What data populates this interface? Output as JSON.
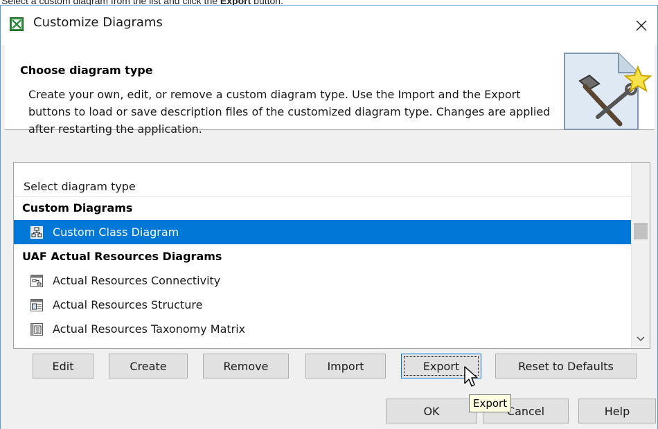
{
  "caption": {
    "prefix": "Select a custom diagram from the list and click the ",
    "bold": "Export",
    "suffix": " button."
  },
  "dialog": {
    "title": "Customize Diagrams",
    "close_glyph": "✕"
  },
  "header": {
    "heading": "Choose diagram type",
    "description": "Create your own, edit, or remove a custom diagram type. Use the Import and the Export buttons to load or save description files of the customized diagram type. Changes are applied after restarting the application."
  },
  "list": {
    "column_header": "Select diagram type",
    "rows": [
      {
        "kind": "group",
        "label": "Custom Diagrams"
      },
      {
        "kind": "item",
        "label": "Custom Class Diagram",
        "icon": "class-diagram-icon",
        "selected": true
      },
      {
        "kind": "group",
        "label": "UAF Actual Resources Diagrams"
      },
      {
        "kind": "item",
        "label": "Actual Resources Connectivity",
        "icon": "connectivity-diagram-icon"
      },
      {
        "kind": "item",
        "label": "Actual Resources Structure",
        "icon": "structure-diagram-icon"
      },
      {
        "kind": "item",
        "label": "Actual Resources Taxonomy Matrix",
        "icon": "matrix-icon"
      }
    ]
  },
  "buttons": {
    "edit": "Edit",
    "create": "Create",
    "remove": "Remove",
    "import": "Import",
    "export": "Export",
    "reset": "Reset to Defaults",
    "ok": "OK",
    "cancel": "Cancel",
    "help": "Help"
  },
  "tooltip": "Export",
  "colors": {
    "selection": "#0078d7",
    "window_border": "#5b9bd5",
    "tooltip_bg": "#ffffe1"
  }
}
